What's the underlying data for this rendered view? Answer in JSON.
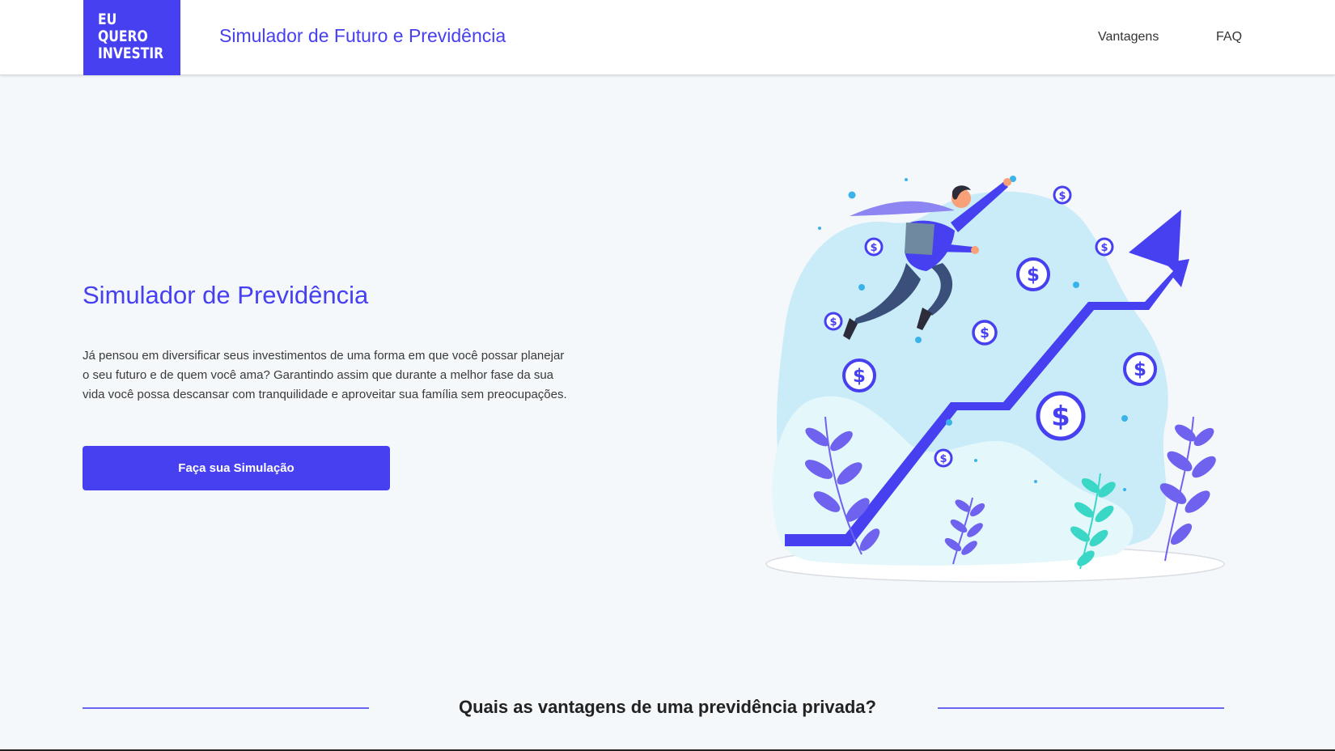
{
  "header": {
    "logo_lines": [
      "EU",
      "QUERO",
      "INVESTIR"
    ],
    "title": "Simulador de Futuro e Previdência",
    "nav": {
      "vantagens": "Vantagens",
      "faq": "FAQ"
    }
  },
  "hero": {
    "title": "Simulador de Previdência",
    "text": "Já pensou em diversificar seus investimentos de uma forma em que você possar planejar o seu futuro e de quem você ama? Garantindo assim que durante a melhor fase da sua vida você possa descansar com tranquilidade e aproveitar sua família sem preocupações.",
    "cta_label": "Faça sua Simulação"
  },
  "illustration": {
    "coin_symbol": "$"
  },
  "section": {
    "heading": "Quais as vantagens de uma previdência privada?"
  },
  "colors": {
    "brand": "#4640f0",
    "background": "#f5f8fa",
    "blob": "#c9ecf8",
    "teal": "#3ad6c6"
  }
}
